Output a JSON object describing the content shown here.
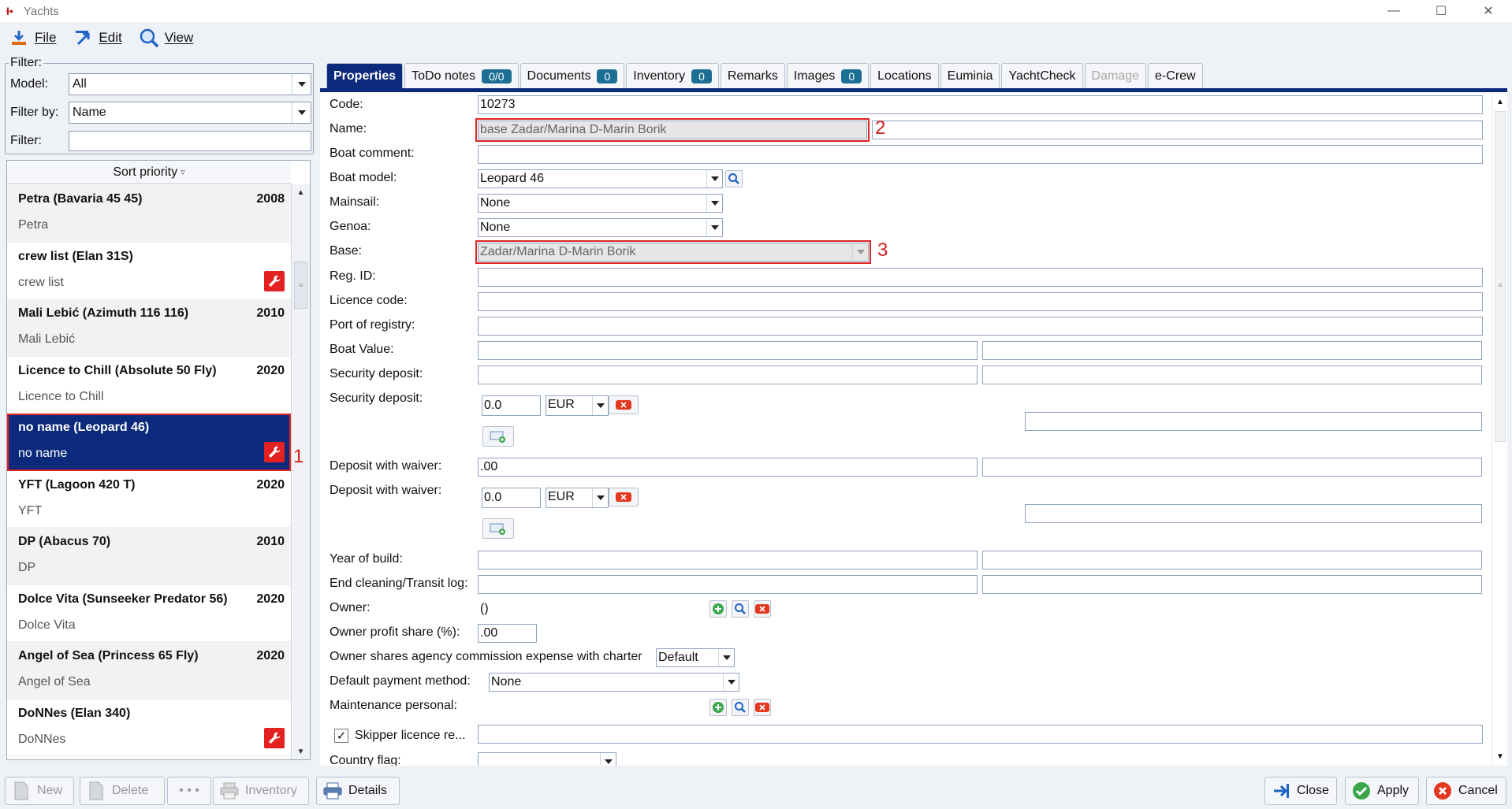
{
  "window": {
    "title": "Yachts"
  },
  "menu": {
    "file": "File",
    "edit": "Edit",
    "view": "View"
  },
  "filter": {
    "legend": "Filter:",
    "model_label": "Model:",
    "model_value": "All",
    "filterby_label": "Filter by:",
    "filterby_value": "Name",
    "filter_label": "Filter:",
    "filter_value": ""
  },
  "list": {
    "header": "Sort priority",
    "items": [
      {
        "name": "Petra (Bavaria 45 45)",
        "year": "2008",
        "sub": "Petra",
        "wrench": false
      },
      {
        "name": "crew list (Elan 31S)",
        "year": "",
        "sub": "crew list",
        "wrench": true
      },
      {
        "name": "Mali Lebić (Azimuth 116 116)",
        "year": "2010",
        "sub": "Mali Lebić",
        "wrench": false
      },
      {
        "name": "Licence to Chill (Absolute 50 Fly)",
        "year": "2020",
        "sub": "Licence to Chill",
        "wrench": false
      },
      {
        "name": "no name (Leopard 46)",
        "year": "",
        "sub": "no name",
        "wrench": true
      },
      {
        "name": "YFT (Lagoon 420 T)",
        "year": "2020",
        "sub": "YFT",
        "wrench": false
      },
      {
        "name": "DP (Abacus 70)",
        "year": "2010",
        "sub": "DP",
        "wrench": false
      },
      {
        "name": "Dolce Vita (Sunseeker Predator 56)",
        "year": "2020",
        "sub": "Dolce Vita",
        "wrench": false
      },
      {
        "name": "Angel of Sea (Princess 65 Fly)",
        "year": "2020",
        "sub": "Angel of Sea",
        "wrench": false
      },
      {
        "name": "DoNNes (Elan 340)",
        "year": "",
        "sub": "DoNNes",
        "wrench": true
      }
    ],
    "selected_index": 4
  },
  "markers": {
    "m1": "1",
    "m2": "2",
    "m3": "3"
  },
  "tabs": [
    {
      "label": "Properties",
      "badge": ""
    },
    {
      "label": "ToDo notes",
      "badge": "0/0"
    },
    {
      "label": "Documents",
      "badge": "0"
    },
    {
      "label": "Inventory",
      "badge": "0"
    },
    {
      "label": "Remarks",
      "badge": ""
    },
    {
      "label": "Images",
      "badge": "0"
    },
    {
      "label": "Locations",
      "badge": ""
    },
    {
      "label": "Euminia",
      "badge": ""
    },
    {
      "label": "YachtCheck",
      "badge": ""
    },
    {
      "label": "Damage",
      "badge": ""
    },
    {
      "label": "e-Crew",
      "badge": ""
    }
  ],
  "props": {
    "code_label": "Code:",
    "code": "10273",
    "name_label": "Name:",
    "name": "base Zadar/Marina D-Marin Borik",
    "comment_label": "Boat comment:",
    "model_label": "Boat model:",
    "model": "Leopard 46",
    "mainsail_label": "Mainsail:",
    "mainsail": "None",
    "genoa_label": "Genoa:",
    "genoa": "None",
    "base_label": "Base:",
    "base": "Zadar/Marina D-Marin Borik",
    "regid_label": "Reg. ID:",
    "licence_label": "Licence code:",
    "port_label": "Port of registry:",
    "value_label": "Boat Value:",
    "secdep1_label": "Security deposit:",
    "secdep2_label": "Security deposit:",
    "secdep_amount": "0.0",
    "secdep_currency": "EUR",
    "waiver1_label": "Deposit with waiver:",
    "waiver1_value": ".00",
    "waiver2_label": "Deposit with waiver:",
    "waiver_amount": "0.0",
    "waiver_currency": "EUR",
    "year_label": "Year of build:",
    "endclean_label": "End cleaning/Transit log:",
    "owner_label": "Owner:",
    "owner_value": "()",
    "share_label": "Owner profit share (%):",
    "share_value": ".00",
    "agency_label": "Owner shares agency commission expense with charter",
    "agency_value": "Default",
    "payment_label": "Default payment method:",
    "payment_value": "None",
    "maint_label": "Maintenance personal:",
    "skipper_label": "Skipper licence re...",
    "skipper_checked": "✓",
    "flag_label": "Country flag:"
  },
  "buttons": {
    "new": "New",
    "delete": "Delete",
    "more": "• • •",
    "inventory": "Inventory",
    "details": "Details",
    "close": "Close",
    "apply": "Apply",
    "cancel": "Cancel"
  }
}
